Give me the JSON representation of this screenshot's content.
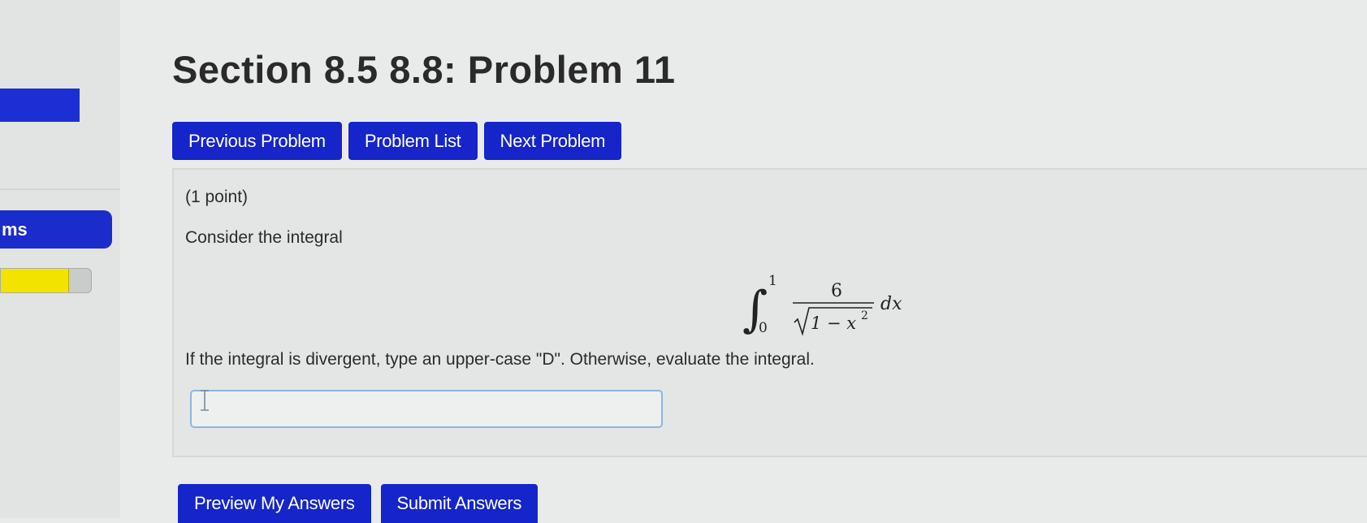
{
  "sidebar": {
    "menu_item_partial": "ms",
    "progress_fraction": 0.75,
    "colors": {
      "nav_blue": "#1a2ccc",
      "progress_yellow": "#f2e400"
    }
  },
  "header": {
    "title": "Section 8.5 8.8: Problem 11"
  },
  "nav": {
    "previous_label": "Previous Problem",
    "list_label": "Problem List",
    "next_label": "Next Problem"
  },
  "problem": {
    "points": "(1 point)",
    "prompt": "Consider the integral",
    "integral": {
      "lower": "0",
      "upper": "1",
      "numerator": "6",
      "radicand": "1 − x",
      "exponent": "2",
      "differential": "dx"
    },
    "instruction": "If the integral is divergent, type an upper-case \"D\". Otherwise, evaluate the integral.",
    "answer_value": ""
  },
  "actions": {
    "preview_label": "Preview My Answers",
    "submit_label": "Submit Answers"
  }
}
